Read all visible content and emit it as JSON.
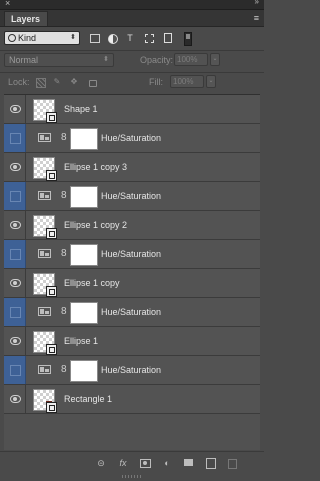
{
  "panel": {
    "close_glyph": "×",
    "collapse_glyph": "»",
    "tab_label": "Layers",
    "menu_glyph": "≡"
  },
  "filter": {
    "kind_label": "Kind",
    "kind_arrow": "⬍",
    "type_icons": [
      "image-filter-icon",
      "adjustment-filter-icon",
      "type-filter-icon",
      "shape-filter-icon",
      "smart-object-filter-icon"
    ],
    "type_glyph": "T"
  },
  "blend": {
    "mode": "Normal",
    "arrow": "⬍",
    "opacity_label": "Opacity:",
    "opacity_value": "100%",
    "fill_label": "Fill:",
    "fill_value": "100%",
    "stepper_glyph": "⌄"
  },
  "lock": {
    "label": "Lock:",
    "icons": [
      "lock-transparent-pixels-icon",
      "lock-image-pixels-icon",
      "lock-position-icon",
      "lock-all-icon"
    ],
    "brush_glyph": "✎",
    "move_glyph": "✥"
  },
  "layers": [
    {
      "name": "Shape 1",
      "kind": "shape",
      "visible": true
    },
    {
      "name": "Hue/Saturation",
      "kind": "adjustment",
      "visible": false
    },
    {
      "name": "Ellipse 1 copy 3",
      "kind": "shape",
      "visible": true
    },
    {
      "name": "Hue/Saturation",
      "kind": "adjustment",
      "visible": false
    },
    {
      "name": "Ellipse 1 copy 2",
      "kind": "shape",
      "visible": true
    },
    {
      "name": "Hue/Saturation",
      "kind": "adjustment",
      "visible": false
    },
    {
      "name": "Ellipse 1 copy",
      "kind": "shape",
      "visible": true
    },
    {
      "name": "Hue/Saturation",
      "kind": "adjustment",
      "visible": false
    },
    {
      "name": "Ellipse 1",
      "kind": "shape",
      "visible": true
    },
    {
      "name": "Hue/Saturation",
      "kind": "adjustment",
      "visible": false
    },
    {
      "name": "Rectangle 1",
      "kind": "shape",
      "visible": true
    }
  ],
  "chain_glyph": "8",
  "bottom": {
    "link_glyph": "⊝",
    "fx_label": "fx",
    "adjust_glyph": "◐",
    "icons": [
      "link-layers-icon",
      "layer-style-icon",
      "add-mask-icon",
      "new-adjustment-icon",
      "new-group-icon",
      "new-layer-icon",
      "delete-layer-icon"
    ]
  },
  "colors": {
    "panel_bg": "#4a4a4a",
    "row_bg": "#535353",
    "hidden_toggle": "#3e6196"
  }
}
